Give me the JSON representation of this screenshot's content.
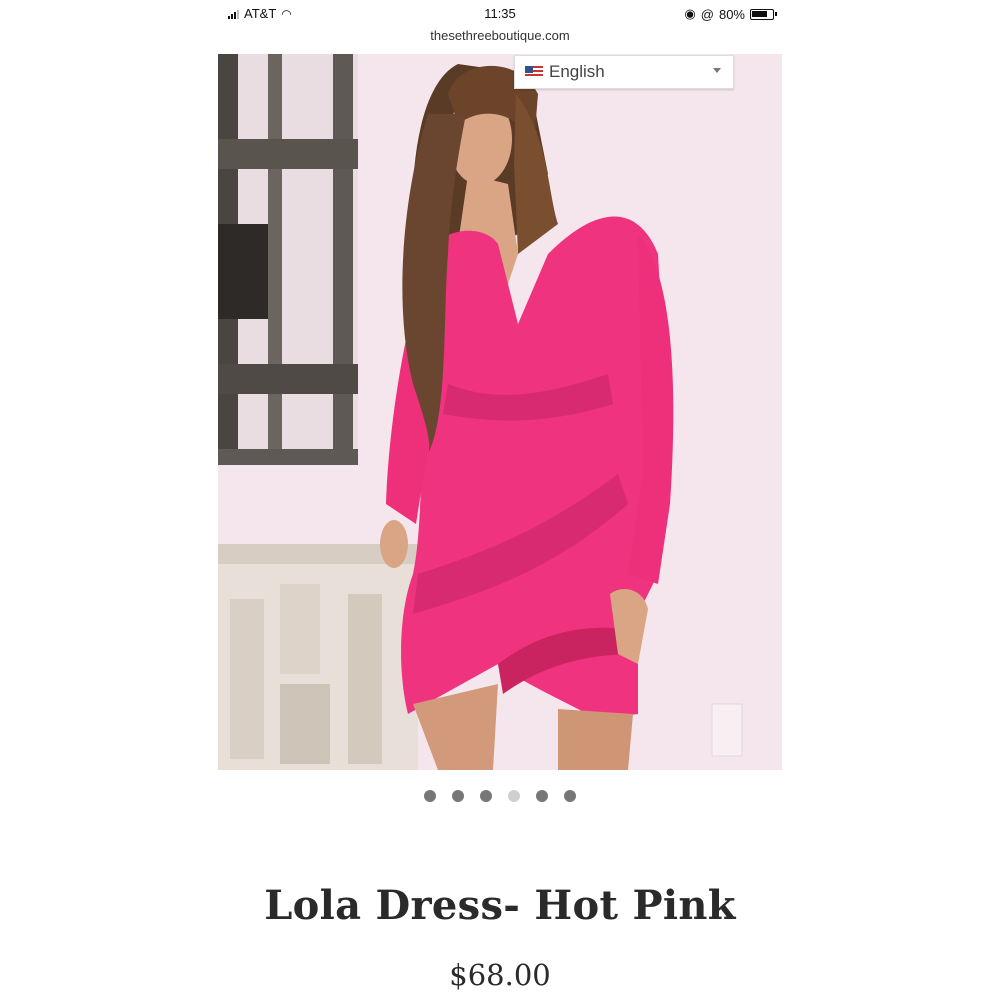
{
  "status_bar": {
    "carrier": "AT&T",
    "time": "11:35",
    "battery": "80%"
  },
  "browser": {
    "url": "thesethreeboutique.com"
  },
  "language_selector": {
    "selected": "English"
  },
  "carousel": {
    "dot_count": 6,
    "active_index": 3
  },
  "product": {
    "title": "Lola Dress- Hot Pink",
    "price": "$68.00",
    "dress_color": "#f0337f"
  }
}
